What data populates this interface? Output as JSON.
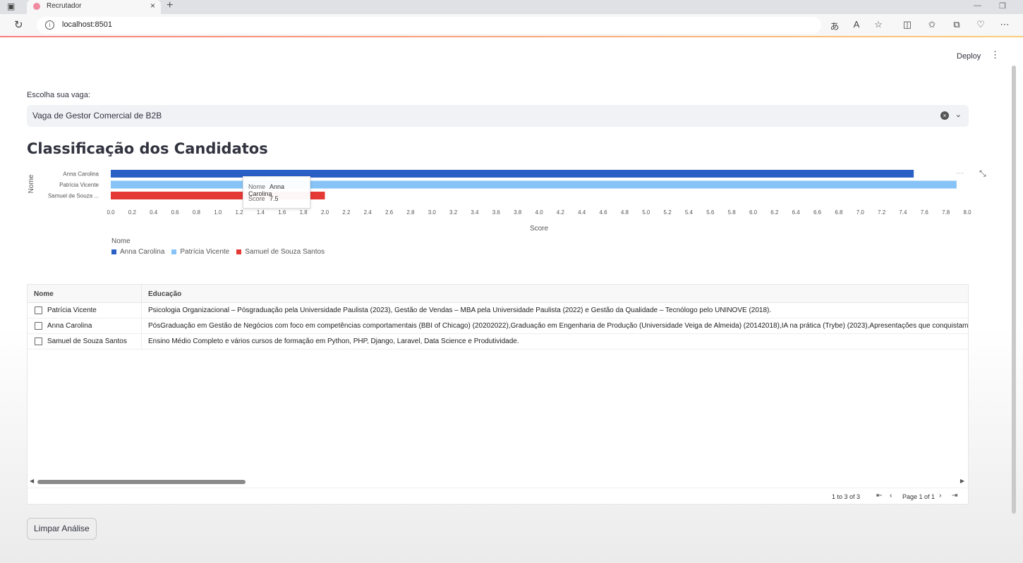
{
  "browser": {
    "tab_title": "Recrutador",
    "url": "localhost:8501",
    "new_tab_symbol": "+",
    "close_symbol": "×"
  },
  "app": {
    "deploy_label": "Deploy",
    "select_label": "Escolha sua vaga:",
    "selected_vaga": "Vaga de Gestor Comercial de B2B",
    "title": "Classificação dos Candidatos",
    "clear_button": "Limpar Análise"
  },
  "chart_data": {
    "type": "bar",
    "orientation": "horizontal",
    "categories": [
      "Anna Carolina",
      "Patrícia Vicente",
      "Samuel de Souza ..."
    ],
    "values": [
      7.5,
      7.9,
      2.0
    ],
    "colors": [
      "#2a5fc6",
      "#87c3f7",
      "#e53935"
    ],
    "xlabel": "Score",
    "ylabel": "Nome",
    "xlim": [
      0,
      8
    ],
    "xticks": [
      "0.0",
      "0.2",
      "0.4",
      "0.6",
      "0.8",
      "1.0",
      "1.2",
      "1.4",
      "1.6",
      "1.8",
      "2.0",
      "2.2",
      "2.4",
      "2.6",
      "2.8",
      "3.0",
      "3.2",
      "3.4",
      "3.6",
      "3.8",
      "4.0",
      "4.2",
      "4.4",
      "4.6",
      "4.8",
      "5.0",
      "5.2",
      "5.4",
      "5.6",
      "5.8",
      "6.0",
      "6.2",
      "6.4",
      "6.6",
      "6.8",
      "7.0",
      "7.2",
      "7.4",
      "7.6",
      "7.8",
      "8.0"
    ],
    "legend_title": "Nome",
    "legend": [
      "Anna Carolina",
      "Patrícia Vicente",
      "Samuel de Souza Santos"
    ],
    "tooltip": {
      "nome_key": "Nome",
      "nome_value": "Anna Carolina",
      "score_key": "Score",
      "score_value": "7.5"
    }
  },
  "grid": {
    "headers": [
      "Nome",
      "Educação"
    ],
    "rows": [
      {
        "nome": "Patrícia Vicente",
        "educacao": "Psicologia Organizacional – Pósgraduação pela Universidade Paulista (2023), Gestão de Vendas – MBA pela Universidade Paulista (2022) e Gestão da Qualidade – Tecnólogo pelo UNINOVE (2018)."
      },
      {
        "nome": "Anna Carolina",
        "educacao": "PósGraduação em Gestão de Negócios com foco em competências comportamentais (BBI of Chicago) (20202022),Graduação em Engenharia de Produção (Universidade Veiga de Almeida) (20142018),IA na prática (Trybe) (2023),Apresentações que conquistam (Con"
      },
      {
        "nome": "Samuel de Souza Santos",
        "educacao": "Ensino Médio Completo e vários cursos de formação em Python, PHP, Django, Laravel, Data Science e Produtividade."
      }
    ],
    "row_count_text": "1 to 3 of 3",
    "page_text": "Page 1 of 1"
  }
}
